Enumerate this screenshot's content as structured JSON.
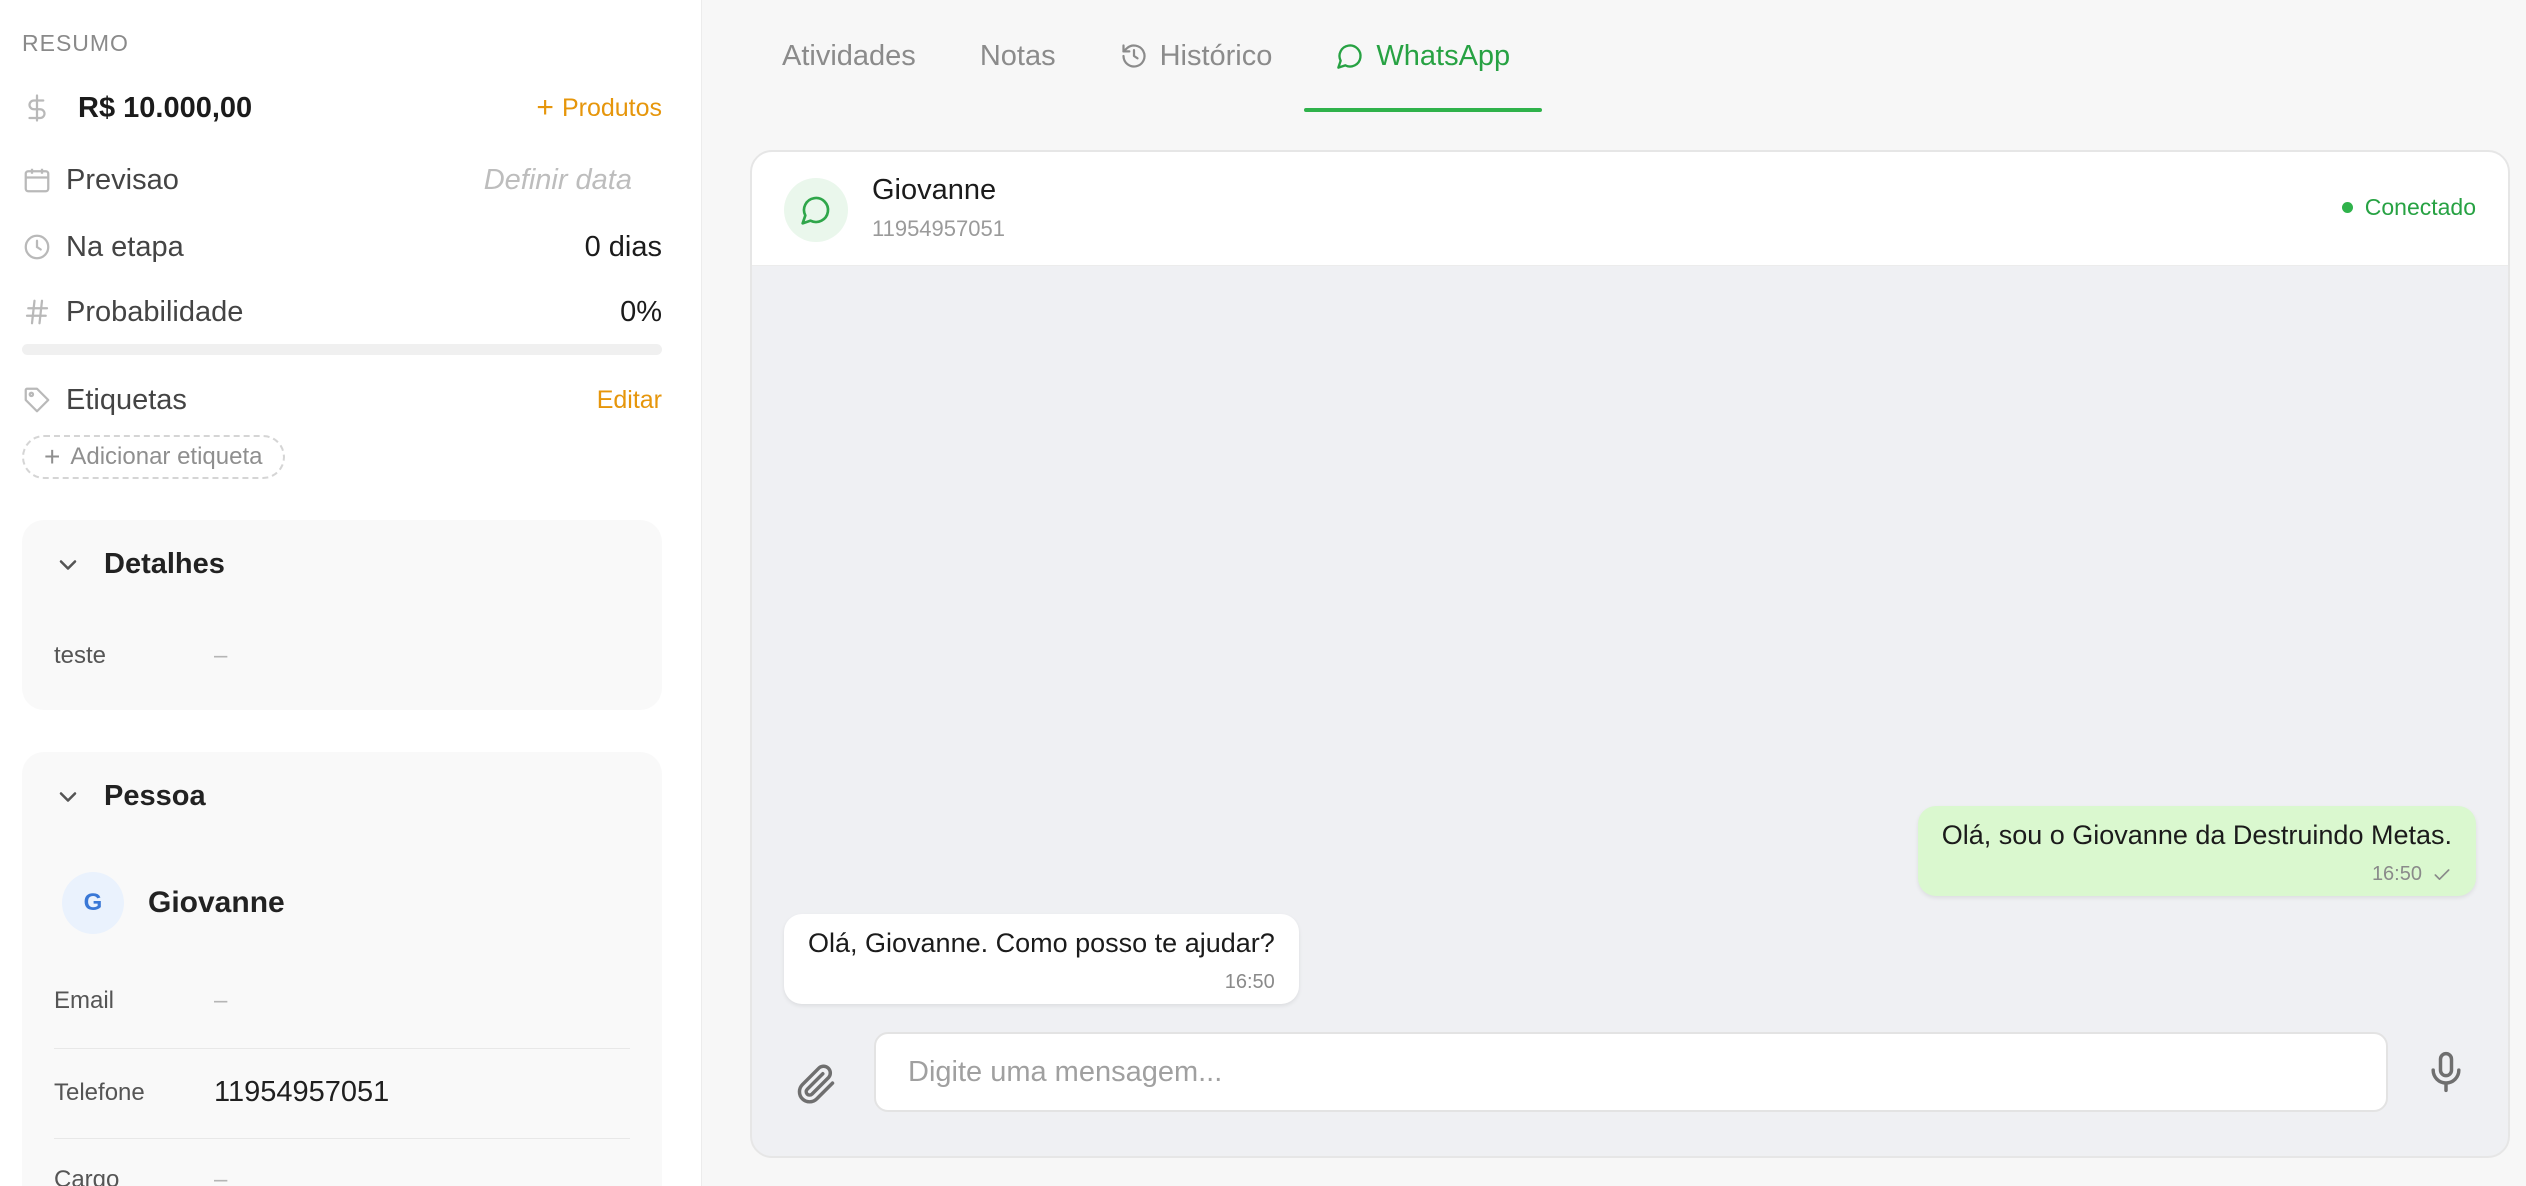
{
  "summary": {
    "section_title": "RESUMO",
    "amount": "R$ 10.000,00",
    "products_label": "Produtos",
    "forecast_label": "Previsao",
    "forecast_placeholder": "Definir data",
    "stage_label": "Na etapa",
    "stage_value": "0 dias",
    "probability_label": "Probabilidade",
    "probability_value": "0%",
    "probability_fraction": 0,
    "tags_label": "Etiquetas",
    "tags_edit": "Editar",
    "add_tag": "Adicionar etiqueta"
  },
  "details": {
    "title": "Detalhes",
    "fields": [
      {
        "key": "teste",
        "value": "–"
      }
    ]
  },
  "person": {
    "title": "Pessoa",
    "avatar_initial": "G",
    "name": "Giovanne",
    "fields": [
      {
        "key": "Email",
        "value": "–"
      },
      {
        "key": "Telefone",
        "value": "11954957051"
      },
      {
        "key": "Cargo",
        "value": "–"
      }
    ]
  },
  "tabs": [
    {
      "label": "Atividades",
      "icon": ""
    },
    {
      "label": "Notas",
      "icon": ""
    },
    {
      "label": "Histórico",
      "icon": "history-icon"
    },
    {
      "label": "WhatsApp",
      "icon": "chat-bubble-icon",
      "active": true
    }
  ],
  "chat": {
    "contact_name": "Giovanne",
    "contact_phone": "11954957051",
    "status": "Conectado",
    "messages": [
      {
        "direction": "out",
        "text": "Olá, sou o Giovanne da Destruindo Metas.",
        "time": "16:50"
      },
      {
        "direction": "in",
        "text": "Olá, Giovanne. Como posso te ajudar?",
        "time": "16:50"
      }
    ],
    "input_placeholder": "Digite uma mensagem..."
  },
  "colors": {
    "accent_orange": "#e6960b",
    "whatsapp_green": "#27a243",
    "outgoing_bubble": "#daf8cf"
  }
}
